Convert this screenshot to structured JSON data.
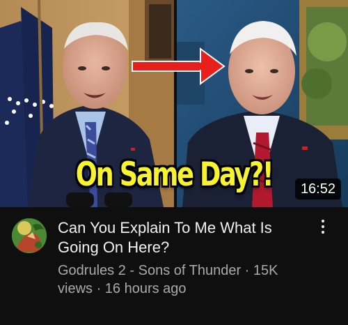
{
  "thumbnail": {
    "caption": "On Same Day?!",
    "duration": "16:52"
  },
  "video": {
    "title": "Can You Explain To Me What Is Going On Here?",
    "channel": "Godrules 2 - Sons of Thunder",
    "separator": " · ",
    "views": "15K views",
    "age": "16 hours ago"
  },
  "icons": {
    "menu": "more-vert-icon",
    "arrow": "red-arrow-icon"
  },
  "colors": {
    "background": "#0f0f0f",
    "caption": "#f7f32e",
    "arrow": "#e8201c",
    "secondary_text": "#aaaaaa"
  }
}
